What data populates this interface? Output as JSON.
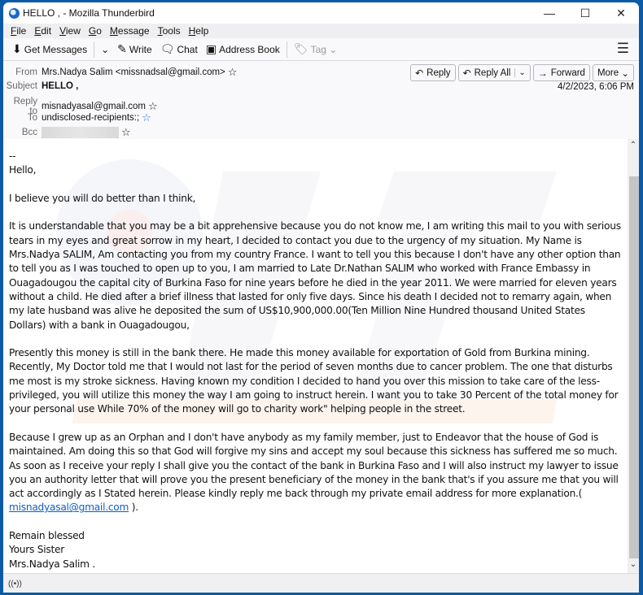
{
  "window": {
    "title": "HELLO , - Mozilla Thunderbird",
    "controls": {
      "minimize": "—",
      "maximize": "☐",
      "close": "✕"
    }
  },
  "menubar": {
    "items": [
      {
        "label": "File",
        "accel": "F",
        "rest": "ile"
      },
      {
        "label": "Edit",
        "accel": "E",
        "rest": "dit"
      },
      {
        "label": "View",
        "accel": "V",
        "rest": "iew"
      },
      {
        "label": "Go",
        "accel": "G",
        "rest": "o"
      },
      {
        "label": "Message",
        "accel": "M",
        "rest": "essage"
      },
      {
        "label": "Tools",
        "accel": "T",
        "rest": "ools"
      },
      {
        "label": "Help",
        "accel": "H",
        "rest": "elp"
      }
    ]
  },
  "toolbar": {
    "get_messages": "Get Messages",
    "write": "Write",
    "chat": "Chat",
    "address_book": "Address Book",
    "tag": "Tag"
  },
  "header": {
    "labels": {
      "from": "From",
      "subject": "Subject",
      "reply_to": "Reply to",
      "to": "To",
      "bcc": "Bcc"
    },
    "from": "Mrs.Nadya Salim <missnadsal@gmail.com>",
    "subject": "HELLO ,",
    "reply_to": "misnadyasal@gmail.com",
    "to": "undisclosed-recipients:;",
    "date": "4/2/2023, 6:06 PM",
    "actions": {
      "reply": "Reply",
      "reply_all": "Reply All",
      "forward": "Forward",
      "more": "More"
    }
  },
  "body": {
    "separator": "--",
    "greeting": "Hello,",
    "p1": "I believe you will do better than I think,",
    "p2": "It is understandable that you may be a bit apprehensive because you do not know me, I am writing this mail to you with serious tears in my eyes and great sorrow in my heart, I decided to contact you due to the urgency of my situation. My Name is Mrs.Nadya SALIM, Am contacting you from my country France. I want to tell you this because I don't have any other option than to tell you as I was touched to open up to you, I am married to Late Dr.Nathan SALIM who worked with France Embassy in Ouagadougou the capital city of Burkina Faso for nine years before he died in the year 2011. We were married for eleven years without a child. He died after a brief illness that lasted for only five days. Since his death I decided not to remarry again, when my late husband was alive he deposited the sum of US$10,900,000.00(Ten Million Nine Hundred thousand United States Dollars) with a bank in Ouagadougou,",
    "p3": "Presently this money is still in the bank there. He made this money available for exportation of Gold from Burkina mining. Recently, My Doctor told me that I would not last for the period of seven months due to cancer problem. The one that disturbs me most is my stroke sickness. Having known my condition I decided to hand you over this mission to take care of the less-privileged, you will utilize this money the way I am going to instruct herein. I want you to take 30 Percent of the total money for your personal use While 70% of the money will go to charity work\" helping people in the street.",
    "p4": "Because I grew up as an Orphan and I don't have anybody as my family member, just to Endeavor that the house of God is maintained. Am doing this so that God will forgive my sins and accept my soul because this sickness has suffered me so much. As soon as I receive your reply I shall give you the contact of the bank in Burkina Faso and I will also instruct my lawyer to issue you an authority letter that will prove you the present beneficiary of the money in the bank that's if you assure me that you will act accordingly as I Stated herein. Please kindly reply me back through my private email address for more explanation.( ",
    "p4_link": "misnadyasal@gmail.com",
    "p4_end": " ).",
    "closing1": "Remain blessed",
    "closing2": "Yours Sister",
    "closing3": "Mrs.Nadya Salim ."
  },
  "colors": {
    "accent": "#0a5aa8",
    "link": "#0b5fc7",
    "star_blue": "#1f7ae0"
  }
}
